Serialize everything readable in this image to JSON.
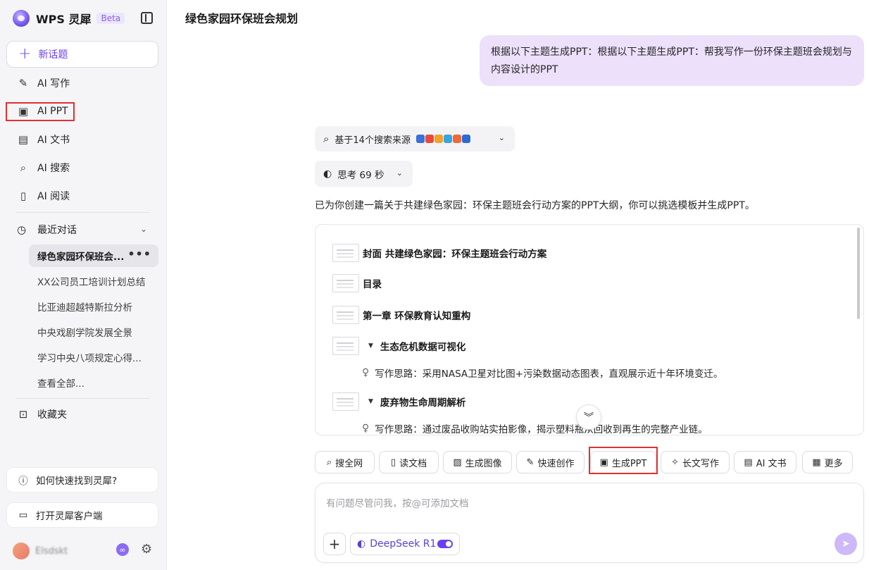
{
  "app": {
    "brand": "WPS 灵犀",
    "beta": "Beta"
  },
  "sidebar": {
    "new_topic": "新话题",
    "nav": [
      {
        "label": "AI 写作",
        "icon": "pen-sparkle-icon"
      },
      {
        "label": "AI PPT",
        "icon": "ppt-icon"
      },
      {
        "label": "AI 文书",
        "icon": "document-icon"
      },
      {
        "label": "AI 搜索",
        "icon": "search-icon"
      },
      {
        "label": "AI 阅读",
        "icon": "book-icon"
      }
    ],
    "recent_label": "最近对话",
    "history": [
      "绿色家园环保班会...",
      "XX公司员工培训计划总结",
      "比亚迪超越特斯拉分析",
      "中央戏剧学院发展全景",
      "学习中央八项规定心得...",
      "查看全部..."
    ],
    "favorites": "收藏夹",
    "help": "如何快速找到灵犀?",
    "client": "打开灵犀客户端",
    "username": "Elsdskt"
  },
  "main": {
    "title": "绿色家园环保班会规划",
    "user_message": "根据以下主题生成PPT：根据以下主题生成PPT：帮我写作一份环保主题班会规划与内容设计的PPT",
    "sources_label": "基于14个搜索来源",
    "think_label": "思考 69 秒",
    "answer": "已为你创建一篇关于共建绿色家园：环保主题班会行动方案的PPT大纲，你可以挑选模板并生成PPT。",
    "outline": [
      {
        "text": "封面 共建绿色家园：环保主题班会行动方案"
      },
      {
        "text": "目录"
      },
      {
        "text": "第一章 环保教育认知重构"
      },
      {
        "text": "生态危机数据可视化",
        "idea": "写作思路：采用NASA卫星对比图+污染数据动态图表，直观展示近十年环境变迁。"
      },
      {
        "text": "废弃物生命周期解析",
        "idea": "写作思路：通过废品收购站实拍影像，揭示塑料瓶从回收到再生的完整产业链。"
      }
    ],
    "tools": [
      "搜全网",
      "读文档",
      "生成图像",
      "快速创作",
      "生成PPT",
      "长文写作",
      "AI 文书",
      "更多"
    ],
    "input_placeholder": "有问题尽管问我，按@可添加文档",
    "model": "DeepSeek R1"
  },
  "colors": {
    "accent": "#6a3ff0",
    "highlight": "#e03131",
    "bubble": "#ece0fb"
  }
}
